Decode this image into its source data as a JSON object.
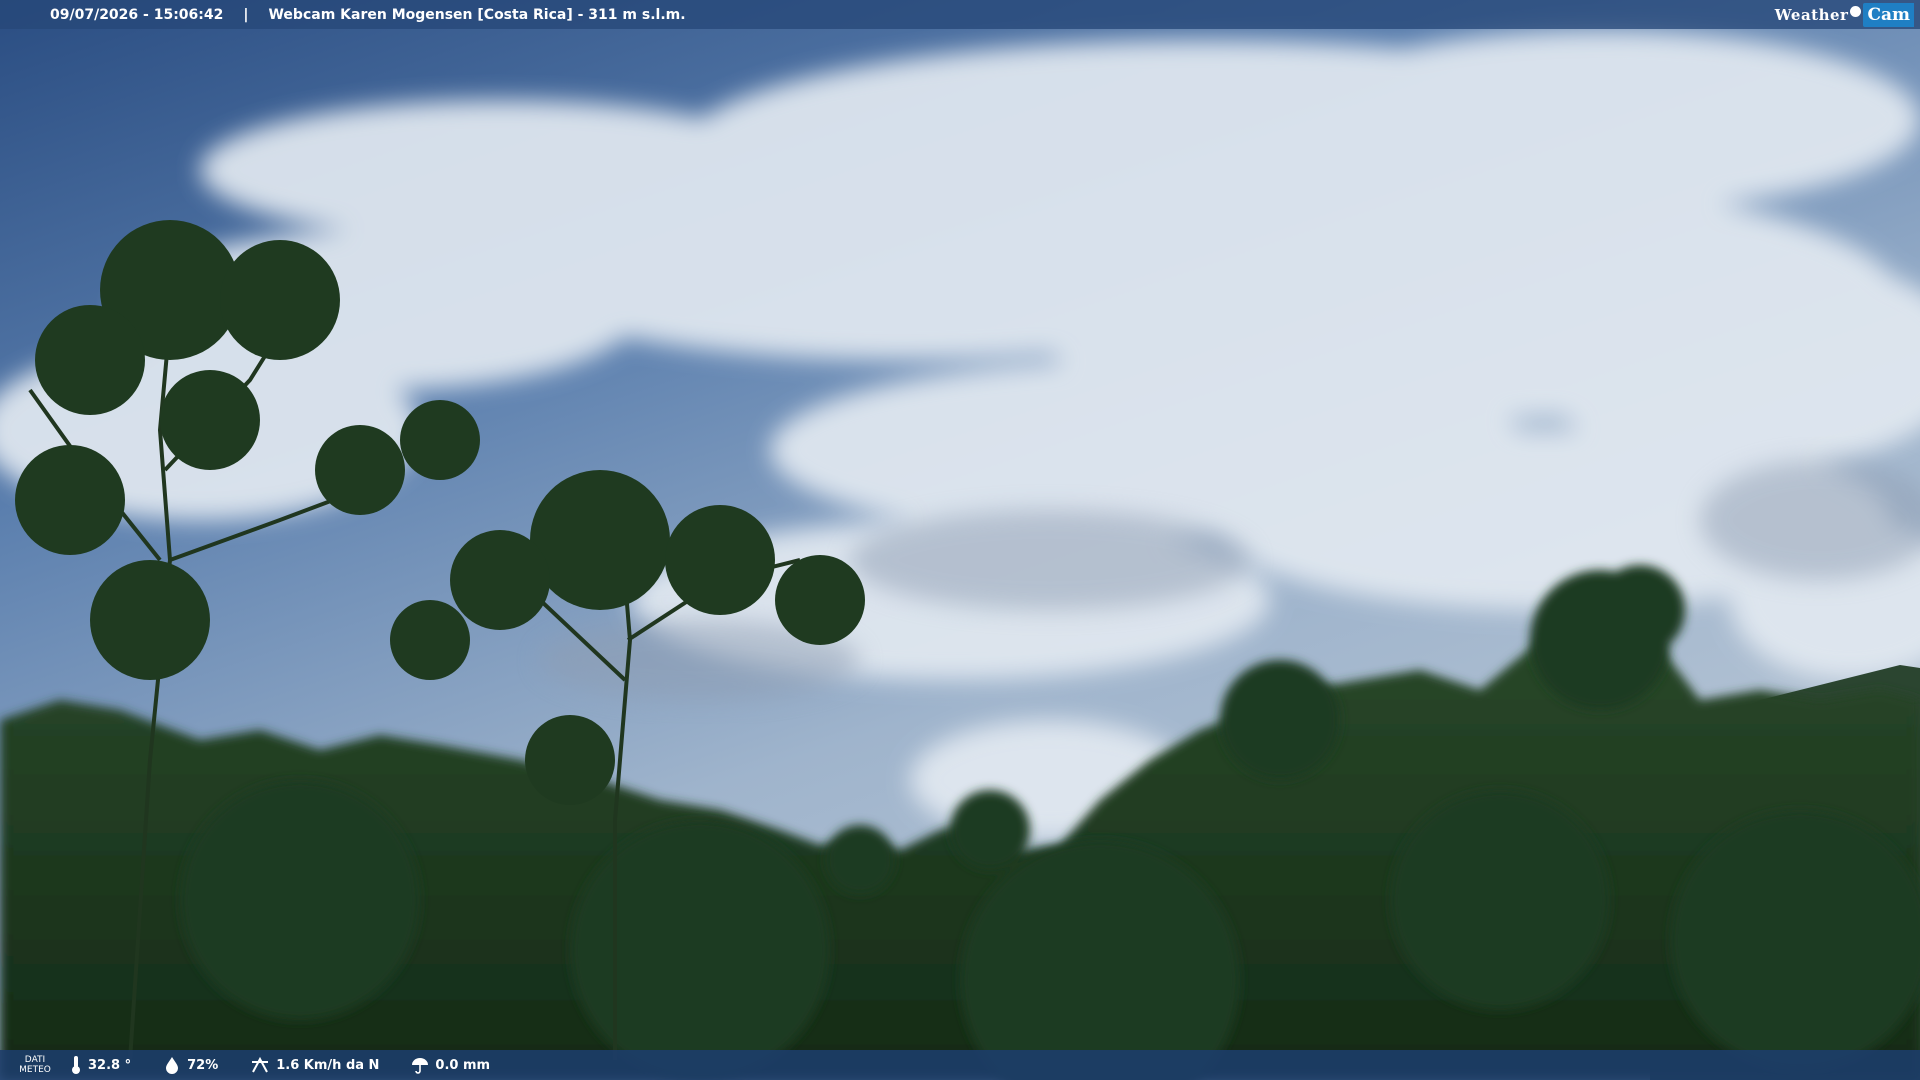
{
  "header": {
    "datetime": "09/07/2026 - 15:06:42",
    "separator": "|",
    "title": "Webcam Karen Mogensen [Costa Rica]  - 311 m s.l.m.",
    "brand_left": "Weather",
    "brand_right": "Cam"
  },
  "footer": {
    "meteo_label_line1": "DATI",
    "meteo_label_line2": "METEO",
    "temperature": "32.8 °",
    "humidity": "72%",
    "wind": "1.6 Km/h da N",
    "rain": "0.0 mm"
  },
  "colors": {
    "sky_top": "#2f5487",
    "cloud": "#dfe7ef",
    "forest": "#1c3a1f",
    "bar": "#264878",
    "brand_blue": "#1f7fc4"
  },
  "icons": [
    "thermometer-icon",
    "humidity-drop-icon",
    "wind-icon",
    "rain-umbrella-icon"
  ]
}
